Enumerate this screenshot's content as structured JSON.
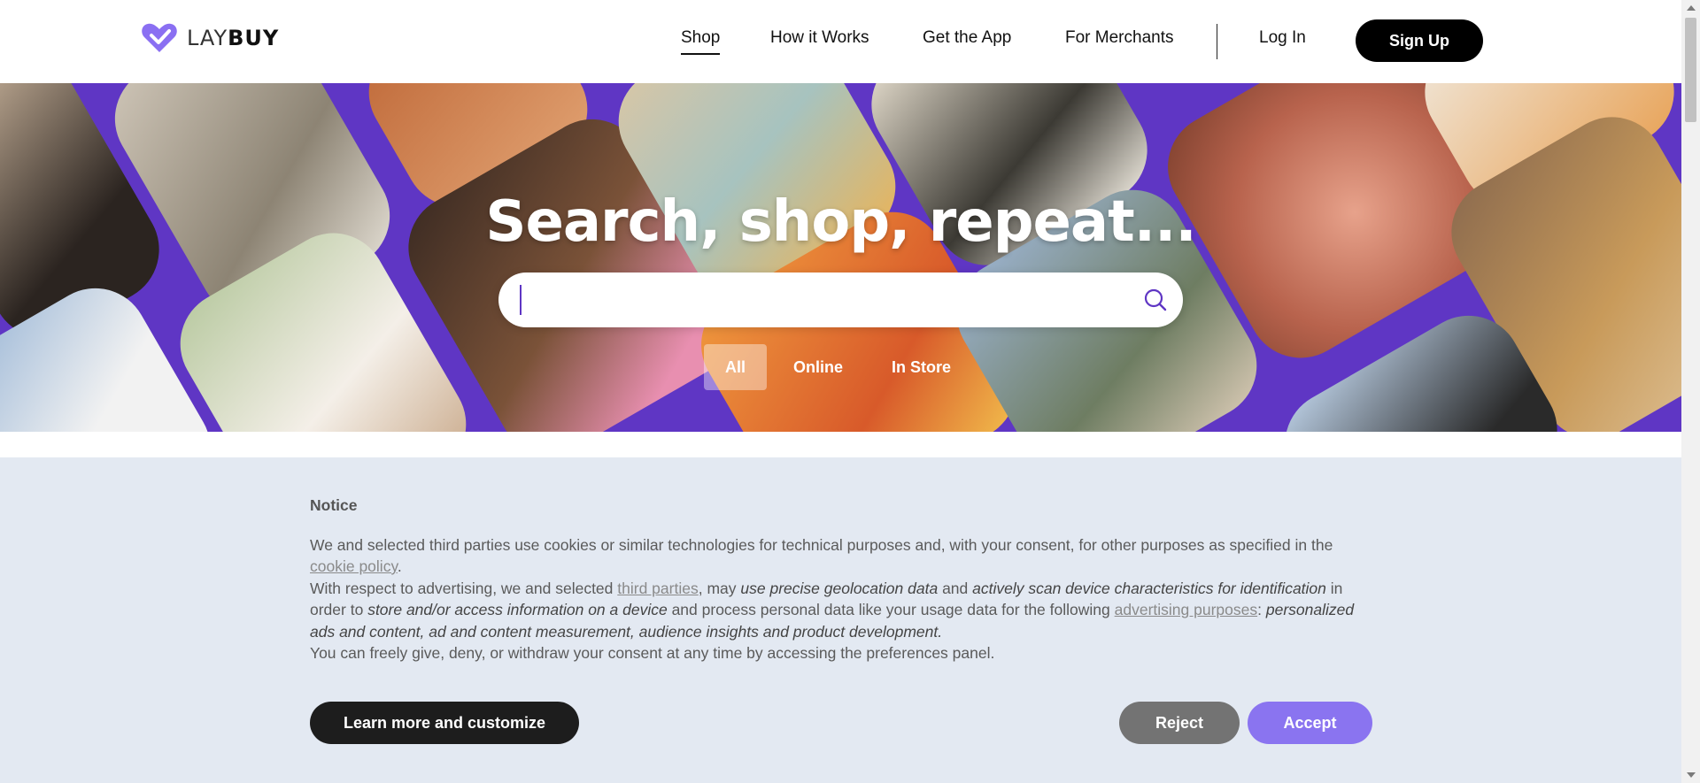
{
  "brand": {
    "name_light": "LAY",
    "name_bold": "BUY",
    "color": "#8a6ff2"
  },
  "nav": {
    "items": [
      {
        "label": "Shop",
        "active": true
      },
      {
        "label": "How it Works",
        "active": false
      },
      {
        "label": "Get the App",
        "active": false
      },
      {
        "label": "For Merchants",
        "active": false
      }
    ],
    "login": "Log In",
    "signup": "Sign Up"
  },
  "hero": {
    "title": "Search, shop, repeat...",
    "background": "#5f36c4",
    "search": {
      "value": "",
      "placeholder": "",
      "icon": "search-icon"
    },
    "filters": [
      {
        "label": "All",
        "active": true
      },
      {
        "label": "Online",
        "active": false
      },
      {
        "label": "In Store",
        "active": false
      }
    ]
  },
  "notice": {
    "title": "Notice",
    "p1_text": "We and selected third parties use cookies or similar technologies for technical purposes and, with your consent, for other purposes as specified in the",
    "p1_link": "cookie policy",
    "p1_end": ".",
    "p2_a": "With respect to advertising, we and selected",
    "p2_link1": "third parties",
    "p2_b": ", may",
    "p2_i1": "use precise geolocation data",
    "p2_c": "and",
    "p2_i2": "actively scan device characteristics for identification",
    "p2_d": "in order to",
    "p2_i3": "store and/or access information on a device",
    "p2_e": "and process personal data like your usage data for the following",
    "p2_link2": "advertising purposes",
    "p2_f": ":",
    "p2_i4": "personalized ads and content, ad and content measurement, audience insights and product development.",
    "p3": "You can freely give, deny, or withdraw your consent at any time by accessing the preferences panel.",
    "buttons": {
      "learn_more": "Learn more and customize",
      "reject": "Reject",
      "accept": "Accept"
    }
  }
}
